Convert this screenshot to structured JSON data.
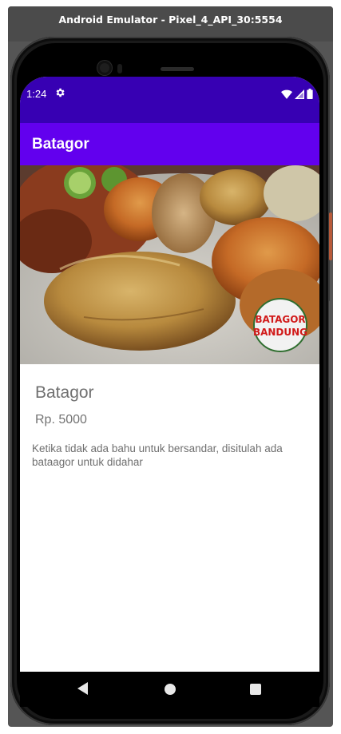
{
  "window": {
    "title": "Android Emulator - Pixel_4_API_30:5554"
  },
  "statusbar": {
    "time": "1:24",
    "icons": [
      "gear-icon",
      "wifi-icon",
      "signal-icon",
      "battery-icon"
    ]
  },
  "appbar": {
    "title": "Batagor"
  },
  "hero": {
    "image_alt": "batagor-photo",
    "logo_line1": "BATAGOR",
    "logo_line2": "BANDUNG"
  },
  "detail": {
    "name": "Batagor",
    "price": "Rp. 5000",
    "description": "Ketika tidak ada bahu untuk bersandar, disitulah ada bataagor untuk didahar"
  },
  "colors": {
    "status_bar": "#3700b3",
    "app_bar": "#6200ee"
  }
}
